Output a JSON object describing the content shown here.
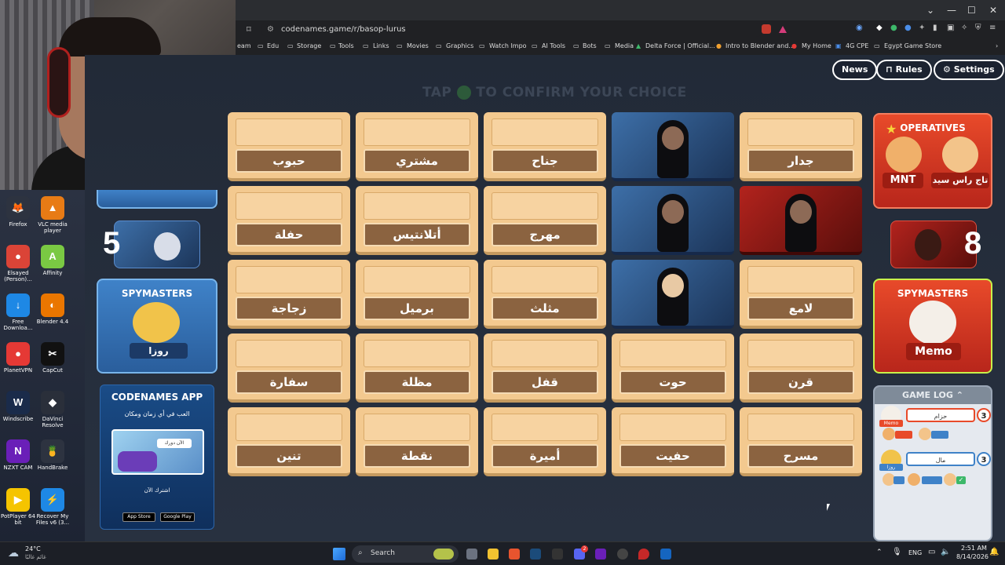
{
  "browser": {
    "url": "codenames.game/r/basop-lurus",
    "bookmarks": [
      "eam",
      "Edu",
      "Storage",
      "Tools",
      "Links",
      "Movies",
      "Graphics",
      "Watch Impo",
      "AI Tools",
      "Bots",
      "Media",
      "Delta Force | Official...",
      "Intro to Blender and...",
      "My Home",
      "4G CPE",
      "Egypt Game Store"
    ]
  },
  "header": {
    "news": "News",
    "rules": "Rules",
    "settings": "Settings",
    "banner_pre": "TAP",
    "banner_post": "TO CONFIRM YOUR CHOICE"
  },
  "board": [
    [
      "حبوب",
      "مشتري",
      "جناح",
      "",
      "جدار"
    ],
    [
      "حفلة",
      "أتلانتيس",
      "مهرج",
      "",
      ""
    ],
    [
      "زجاجة",
      "برميل",
      "مثلث",
      "",
      "لامع"
    ],
    [
      "سفارة",
      "مظلة",
      "قفل",
      "حوت",
      "قرن"
    ],
    [
      "تنين",
      "نقطة",
      "أميرة",
      "حفيت",
      "مسرح"
    ]
  ],
  "blue_team": {
    "count": "5",
    "spymasters_title": "SPYMASTERS",
    "spymaster_name": "روزا"
  },
  "red_team": {
    "operatives_title": "OPERATIVES",
    "operative_1": "MNT",
    "operative_2": "تاج راس سيد",
    "count": "8",
    "spymasters_title": "SPYMASTERS",
    "spymaster_name": "Memo"
  },
  "promo": {
    "title": "CODENAMES APP",
    "subtitle": "العب في أي زمان ومكان",
    "badge": "الآن دورك",
    "cta": "اشترك الآن",
    "appstore": "App Store",
    "googleplay": "Google Play"
  },
  "game_log": {
    "title": "GAME LOG",
    "entries": [
      {
        "clue": "حزام",
        "num": "3",
        "who": "Memo",
        "color": "#e84a2a"
      },
      {
        "clue": "مال",
        "num": "3",
        "who": "روزا",
        "color": "#3f82c8"
      }
    ]
  },
  "desktop_icons": [
    {
      "label": "Firefox",
      "glyph": "🦊",
      "bg": "#2d3340"
    },
    {
      "label": "VLC media player",
      "glyph": "▲",
      "bg": "#e87b15"
    },
    {
      "label": "Elsayed (Person)...",
      "glyph": "●",
      "bg": "#db4437"
    },
    {
      "label": "Affinity",
      "glyph": "A",
      "bg": "#7ac943"
    },
    {
      "label": "Free Downloa...",
      "glyph": "↓",
      "bg": "#1e88e5"
    },
    {
      "label": "Blender 4.4",
      "glyph": "◐",
      "bg": "#ea7600"
    },
    {
      "label": "PlanetVPN",
      "glyph": "●",
      "bg": "#e53935"
    },
    {
      "label": "CapCut",
      "glyph": "✂",
      "bg": "#111"
    },
    {
      "label": "Windscribe",
      "glyph": "W",
      "bg": "#1a2b4a"
    },
    {
      "label": "DaVinci Resolve",
      "glyph": "◆",
      "bg": "#2a2f3a"
    },
    {
      "label": "NZXT CAM",
      "glyph": "N",
      "bg": "#6a1fb8"
    },
    {
      "label": "HandBrake",
      "glyph": "🍍",
      "bg": "#2d3340"
    },
    {
      "label": "PotPlayer 64 bit",
      "glyph": "▶",
      "bg": "#f5c400"
    },
    {
      "label": "Recover My Files v6 (3...",
      "glyph": "⚡",
      "bg": "#1e88e5"
    }
  ],
  "taskbar": {
    "weather_temp": "24°C",
    "weather_desc": "غائم غالبًا",
    "search": "Search",
    "lang": "ENG",
    "time": "2:51 AM",
    "date": "8/14/2026",
    "notif": "2"
  }
}
